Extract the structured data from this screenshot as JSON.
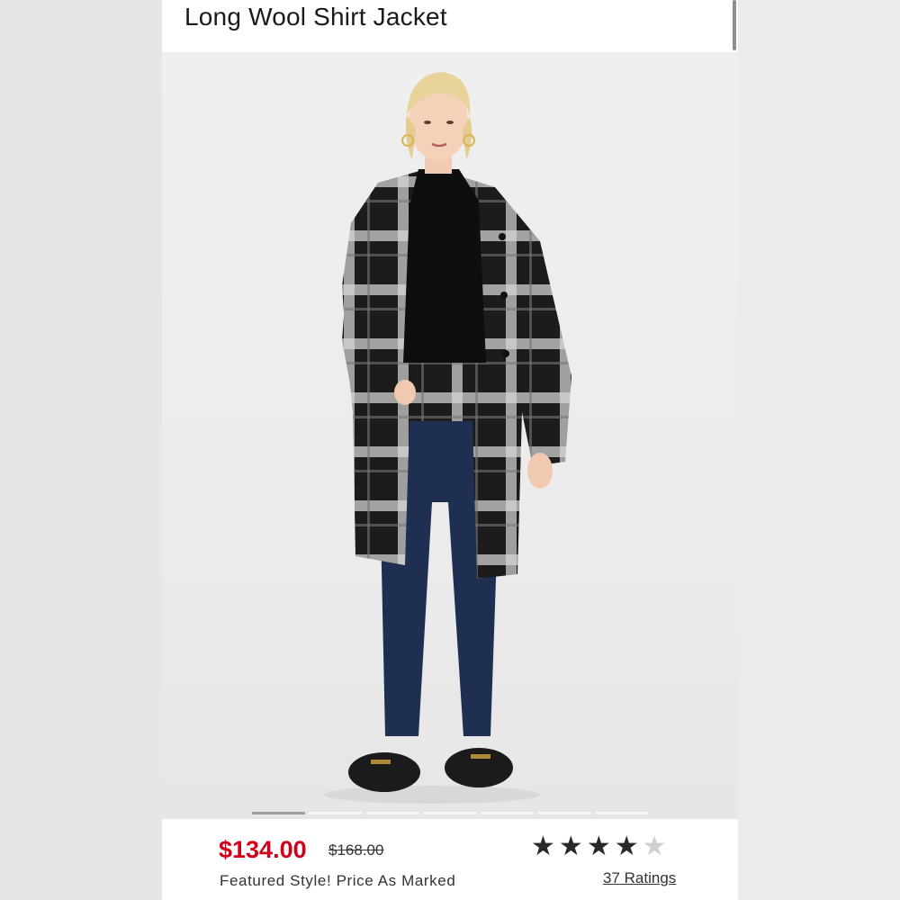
{
  "product": {
    "title": "Long Wool Shirt Jacket",
    "price": "$134.00",
    "original_price": "$168.00",
    "promo_text": "Featured Style! Price As Marked",
    "rating": 4,
    "rating_max": 5,
    "ratings_link": "37 Ratings"
  },
  "gallery": {
    "image_alt": "Model wearing long black and white plaid wool shirt jacket with dark jeans and loafers",
    "slide_count": 7,
    "active_slide": 1
  },
  "colors": {
    "price_red": "#d0001b",
    "star_filled": "#2a2a2a",
    "star_empty": "#cfcfcf"
  }
}
